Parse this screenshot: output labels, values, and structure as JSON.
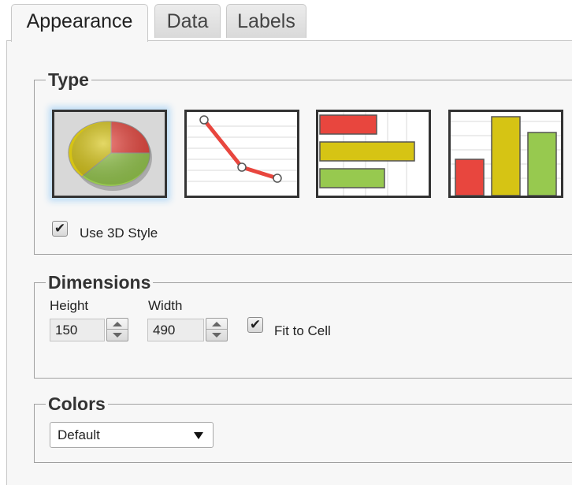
{
  "tabs": [
    {
      "label": "Appearance",
      "active": true
    },
    {
      "label": "Data",
      "active": false
    },
    {
      "label": "Labels",
      "active": false
    }
  ],
  "type_group": {
    "legend": "Type",
    "options": [
      {
        "name": "pie",
        "icon": "pie-chart-icon",
        "selected": true
      },
      {
        "name": "line",
        "icon": "line-chart-icon",
        "selected": false
      },
      {
        "name": "horizontal-bar",
        "icon": "horizontal-bar-chart-icon",
        "selected": false
      },
      {
        "name": "vertical-bar",
        "icon": "vertical-bar-chart-icon",
        "selected": false
      }
    ],
    "use_3d_label": "Use 3D Style",
    "use_3d_checked": true
  },
  "dimensions_group": {
    "legend": "Dimensions",
    "height_label": "Height",
    "height_value": "150",
    "width_label": "Width",
    "width_value": "490",
    "fit_label": "Fit to Cell",
    "fit_checked": true
  },
  "colors_group": {
    "legend": "Colors",
    "selected": "Default"
  },
  "colors": {
    "red": "#e8463e",
    "yellow": "#d6c414",
    "green": "#97c94f",
    "selection_glow": "#bcdcf6"
  },
  "check_glyph": "✔"
}
